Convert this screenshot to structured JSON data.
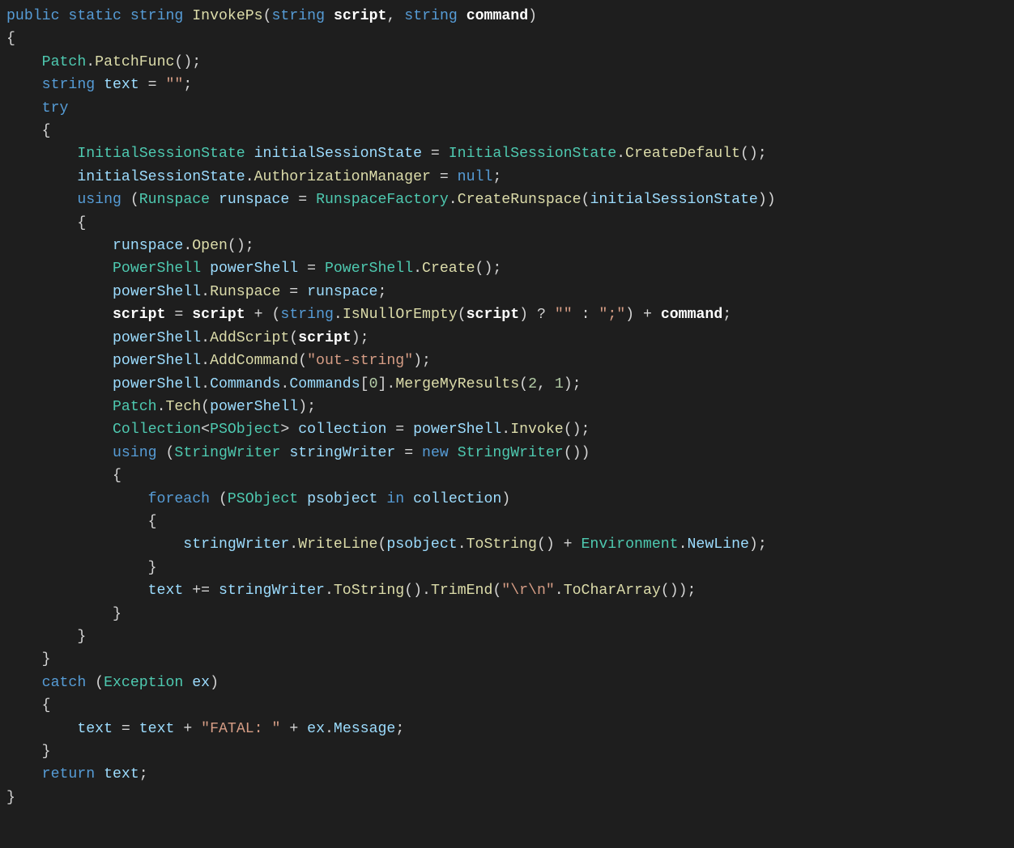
{
  "code": {
    "language": "csharp",
    "method_name": "InvokePs",
    "lines": [
      {
        "indent": 0,
        "tokens": [
          {
            "c": "kw",
            "t": "public"
          },
          {
            "c": "punc",
            "t": " "
          },
          {
            "c": "kw",
            "t": "static"
          },
          {
            "c": "punc",
            "t": " "
          },
          {
            "c": "kw",
            "t": "string"
          },
          {
            "c": "punc",
            "t": " "
          },
          {
            "c": "method",
            "t": "InvokePs"
          },
          {
            "c": "punc",
            "t": "("
          },
          {
            "c": "kw",
            "t": "string"
          },
          {
            "c": "punc",
            "t": " "
          },
          {
            "c": "wht",
            "t": "script"
          },
          {
            "c": "punc",
            "t": ", "
          },
          {
            "c": "kw",
            "t": "string"
          },
          {
            "c": "punc",
            "t": " "
          },
          {
            "c": "wht",
            "t": "command"
          },
          {
            "c": "punc",
            "t": ")"
          }
        ]
      },
      {
        "indent": 0,
        "tokens": [
          {
            "c": "punc",
            "t": "{"
          }
        ]
      },
      {
        "indent": 1,
        "tokens": [
          {
            "c": "type",
            "t": "Patch"
          },
          {
            "c": "punc",
            "t": "."
          },
          {
            "c": "method",
            "t": "PatchFunc"
          },
          {
            "c": "punc",
            "t": "();"
          }
        ]
      },
      {
        "indent": 1,
        "tokens": [
          {
            "c": "kw",
            "t": "string"
          },
          {
            "c": "punc",
            "t": " "
          },
          {
            "c": "var",
            "t": "text"
          },
          {
            "c": "punc",
            "t": " = "
          },
          {
            "c": "str",
            "t": "\"\""
          },
          {
            "c": "punc",
            "t": ";"
          }
        ]
      },
      {
        "indent": 1,
        "tokens": [
          {
            "c": "kw",
            "t": "try"
          }
        ]
      },
      {
        "indent": 1,
        "tokens": [
          {
            "c": "punc",
            "t": "{"
          }
        ]
      },
      {
        "indent": 2,
        "tokens": [
          {
            "c": "type",
            "t": "InitialSessionState"
          },
          {
            "c": "punc",
            "t": " "
          },
          {
            "c": "var",
            "t": "initialSessionState"
          },
          {
            "c": "punc",
            "t": " = "
          },
          {
            "c": "type",
            "t": "InitialSessionState"
          },
          {
            "c": "punc",
            "t": "."
          },
          {
            "c": "method",
            "t": "CreateDefault"
          },
          {
            "c": "punc",
            "t": "();"
          }
        ]
      },
      {
        "indent": 2,
        "tokens": [
          {
            "c": "var",
            "t": "initialSessionState"
          },
          {
            "c": "punc",
            "t": "."
          },
          {
            "c": "method",
            "t": "AuthorizationManager"
          },
          {
            "c": "punc",
            "t": " = "
          },
          {
            "c": "kw",
            "t": "null"
          },
          {
            "c": "punc",
            "t": ";"
          }
        ]
      },
      {
        "indent": 2,
        "tokens": [
          {
            "c": "kw",
            "t": "using"
          },
          {
            "c": "punc",
            "t": " ("
          },
          {
            "c": "type",
            "t": "Runspace"
          },
          {
            "c": "punc",
            "t": " "
          },
          {
            "c": "var",
            "t": "runspace"
          },
          {
            "c": "punc",
            "t": " = "
          },
          {
            "c": "type",
            "t": "RunspaceFactory"
          },
          {
            "c": "punc",
            "t": "."
          },
          {
            "c": "method",
            "t": "CreateRunspace"
          },
          {
            "c": "punc",
            "t": "("
          },
          {
            "c": "var",
            "t": "initialSessionState"
          },
          {
            "c": "punc",
            "t": "))"
          }
        ]
      },
      {
        "indent": 2,
        "tokens": [
          {
            "c": "punc",
            "t": "{"
          }
        ]
      },
      {
        "indent": 3,
        "tokens": [
          {
            "c": "var",
            "t": "runspace"
          },
          {
            "c": "punc",
            "t": "."
          },
          {
            "c": "method",
            "t": "Open"
          },
          {
            "c": "punc",
            "t": "();"
          }
        ]
      },
      {
        "indent": 3,
        "tokens": [
          {
            "c": "type",
            "t": "PowerShell"
          },
          {
            "c": "punc",
            "t": " "
          },
          {
            "c": "var",
            "t": "powerShell"
          },
          {
            "c": "punc",
            "t": " = "
          },
          {
            "c": "type",
            "t": "PowerShell"
          },
          {
            "c": "punc",
            "t": "."
          },
          {
            "c": "method",
            "t": "Create"
          },
          {
            "c": "punc",
            "t": "();"
          }
        ]
      },
      {
        "indent": 3,
        "tokens": [
          {
            "c": "var",
            "t": "powerShell"
          },
          {
            "c": "punc",
            "t": "."
          },
          {
            "c": "method",
            "t": "Runspace"
          },
          {
            "c": "punc",
            "t": " = "
          },
          {
            "c": "var",
            "t": "runspace"
          },
          {
            "c": "punc",
            "t": ";"
          }
        ]
      },
      {
        "indent": 3,
        "tokens": [
          {
            "c": "wht",
            "t": "script"
          },
          {
            "c": "punc",
            "t": " = "
          },
          {
            "c": "wht",
            "t": "script"
          },
          {
            "c": "punc",
            "t": " + ("
          },
          {
            "c": "kw",
            "t": "string"
          },
          {
            "c": "punc",
            "t": "."
          },
          {
            "c": "method",
            "t": "IsNullOrEmpty"
          },
          {
            "c": "punc",
            "t": "("
          },
          {
            "c": "wht",
            "t": "script"
          },
          {
            "c": "punc",
            "t": ") ? "
          },
          {
            "c": "str",
            "t": "\"\""
          },
          {
            "c": "punc",
            "t": " : "
          },
          {
            "c": "str",
            "t": "\";\""
          },
          {
            "c": "punc",
            "t": ") + "
          },
          {
            "c": "wht",
            "t": "command"
          },
          {
            "c": "punc",
            "t": ";"
          }
        ]
      },
      {
        "indent": 3,
        "tokens": [
          {
            "c": "var",
            "t": "powerShell"
          },
          {
            "c": "punc",
            "t": "."
          },
          {
            "c": "method",
            "t": "AddScript"
          },
          {
            "c": "punc",
            "t": "("
          },
          {
            "c": "wht",
            "t": "script"
          },
          {
            "c": "punc",
            "t": ");"
          }
        ]
      },
      {
        "indent": 3,
        "tokens": [
          {
            "c": "var",
            "t": "powerShell"
          },
          {
            "c": "punc",
            "t": "."
          },
          {
            "c": "method",
            "t": "AddCommand"
          },
          {
            "c": "punc",
            "t": "("
          },
          {
            "c": "str",
            "t": "\"out-string\""
          },
          {
            "c": "punc",
            "t": ");"
          }
        ]
      },
      {
        "indent": 3,
        "tokens": [
          {
            "c": "var",
            "t": "powerShell"
          },
          {
            "c": "punc",
            "t": "."
          },
          {
            "c": "var",
            "t": "Commands"
          },
          {
            "c": "punc",
            "t": "."
          },
          {
            "c": "var",
            "t": "Commands"
          },
          {
            "c": "punc",
            "t": "["
          },
          {
            "c": "num",
            "t": "0"
          },
          {
            "c": "punc",
            "t": "]."
          },
          {
            "c": "method",
            "t": "MergeMyResults"
          },
          {
            "c": "punc",
            "t": "("
          },
          {
            "c": "num",
            "t": "2"
          },
          {
            "c": "punc",
            "t": ", "
          },
          {
            "c": "num",
            "t": "1"
          },
          {
            "c": "punc",
            "t": ");"
          }
        ]
      },
      {
        "indent": 3,
        "tokens": [
          {
            "c": "type",
            "t": "Patch"
          },
          {
            "c": "punc",
            "t": "."
          },
          {
            "c": "method",
            "t": "Tech"
          },
          {
            "c": "punc",
            "t": "("
          },
          {
            "c": "var",
            "t": "powerShell"
          },
          {
            "c": "punc",
            "t": ");"
          }
        ]
      },
      {
        "indent": 3,
        "tokens": [
          {
            "c": "type",
            "t": "Collection"
          },
          {
            "c": "punc",
            "t": "<"
          },
          {
            "c": "type",
            "t": "PSObject"
          },
          {
            "c": "punc",
            "t": "> "
          },
          {
            "c": "var",
            "t": "collection"
          },
          {
            "c": "punc",
            "t": " = "
          },
          {
            "c": "var",
            "t": "powerShell"
          },
          {
            "c": "punc",
            "t": "."
          },
          {
            "c": "method",
            "t": "Invoke"
          },
          {
            "c": "punc",
            "t": "();"
          }
        ]
      },
      {
        "indent": 3,
        "tokens": [
          {
            "c": "kw",
            "t": "using"
          },
          {
            "c": "punc",
            "t": " ("
          },
          {
            "c": "type",
            "t": "StringWriter"
          },
          {
            "c": "punc",
            "t": " "
          },
          {
            "c": "var",
            "t": "stringWriter"
          },
          {
            "c": "punc",
            "t": " = "
          },
          {
            "c": "kw",
            "t": "new"
          },
          {
            "c": "punc",
            "t": " "
          },
          {
            "c": "type",
            "t": "StringWriter"
          },
          {
            "c": "punc",
            "t": "())"
          }
        ]
      },
      {
        "indent": 3,
        "tokens": [
          {
            "c": "punc",
            "t": "{"
          }
        ]
      },
      {
        "indent": 4,
        "tokens": [
          {
            "c": "kw",
            "t": "foreach"
          },
          {
            "c": "punc",
            "t": " ("
          },
          {
            "c": "type",
            "t": "PSObject"
          },
          {
            "c": "punc",
            "t": " "
          },
          {
            "c": "var",
            "t": "psobject"
          },
          {
            "c": "punc",
            "t": " "
          },
          {
            "c": "kw",
            "t": "in"
          },
          {
            "c": "punc",
            "t": " "
          },
          {
            "c": "var",
            "t": "collection"
          },
          {
            "c": "punc",
            "t": ")"
          }
        ]
      },
      {
        "indent": 4,
        "tokens": [
          {
            "c": "punc",
            "t": "{"
          }
        ]
      },
      {
        "indent": 5,
        "tokens": [
          {
            "c": "var",
            "t": "stringWriter"
          },
          {
            "c": "punc",
            "t": "."
          },
          {
            "c": "method",
            "t": "WriteLine"
          },
          {
            "c": "punc",
            "t": "("
          },
          {
            "c": "var",
            "t": "psobject"
          },
          {
            "c": "punc",
            "t": "."
          },
          {
            "c": "method",
            "t": "ToString"
          },
          {
            "c": "punc",
            "t": "() + "
          },
          {
            "c": "type",
            "t": "Environment"
          },
          {
            "c": "punc",
            "t": "."
          },
          {
            "c": "var",
            "t": "NewLine"
          },
          {
            "c": "punc",
            "t": ");"
          }
        ]
      },
      {
        "indent": 4,
        "tokens": [
          {
            "c": "punc",
            "t": "}"
          }
        ]
      },
      {
        "indent": 4,
        "tokens": [
          {
            "c": "var",
            "t": "text"
          },
          {
            "c": "punc",
            "t": " += "
          },
          {
            "c": "var",
            "t": "stringWriter"
          },
          {
            "c": "punc",
            "t": "."
          },
          {
            "c": "method",
            "t": "ToString"
          },
          {
            "c": "punc",
            "t": "()."
          },
          {
            "c": "method",
            "t": "TrimEnd"
          },
          {
            "c": "punc",
            "t": "("
          },
          {
            "c": "str",
            "t": "\"\\r\\n\""
          },
          {
            "c": "punc",
            "t": "."
          },
          {
            "c": "method",
            "t": "ToCharArray"
          },
          {
            "c": "punc",
            "t": "());"
          }
        ]
      },
      {
        "indent": 3,
        "tokens": [
          {
            "c": "punc",
            "t": "}"
          }
        ]
      },
      {
        "indent": 2,
        "tokens": [
          {
            "c": "punc",
            "t": "}"
          }
        ]
      },
      {
        "indent": 1,
        "tokens": [
          {
            "c": "punc",
            "t": "}"
          }
        ]
      },
      {
        "indent": 1,
        "tokens": [
          {
            "c": "kw",
            "t": "catch"
          },
          {
            "c": "punc",
            "t": " ("
          },
          {
            "c": "type",
            "t": "Exception"
          },
          {
            "c": "punc",
            "t": " "
          },
          {
            "c": "var",
            "t": "ex"
          },
          {
            "c": "punc",
            "t": ")"
          }
        ]
      },
      {
        "indent": 1,
        "tokens": [
          {
            "c": "punc",
            "t": "{"
          }
        ]
      },
      {
        "indent": 2,
        "tokens": [
          {
            "c": "var",
            "t": "text"
          },
          {
            "c": "punc",
            "t": " = "
          },
          {
            "c": "var",
            "t": "text"
          },
          {
            "c": "punc",
            "t": " + "
          },
          {
            "c": "str",
            "t": "\"FATAL: \""
          },
          {
            "c": "punc",
            "t": " + "
          },
          {
            "c": "var",
            "t": "ex"
          },
          {
            "c": "punc",
            "t": "."
          },
          {
            "c": "var",
            "t": "Message"
          },
          {
            "c": "punc",
            "t": ";"
          }
        ]
      },
      {
        "indent": 1,
        "tokens": [
          {
            "c": "punc",
            "t": "}"
          }
        ]
      },
      {
        "indent": 1,
        "tokens": [
          {
            "c": "kw",
            "t": "return"
          },
          {
            "c": "punc",
            "t": " "
          },
          {
            "c": "var",
            "t": "text"
          },
          {
            "c": "punc",
            "t": ";"
          }
        ]
      },
      {
        "indent": 0,
        "tokens": [
          {
            "c": "punc",
            "t": "}"
          }
        ]
      }
    ],
    "indent_string": "    "
  }
}
